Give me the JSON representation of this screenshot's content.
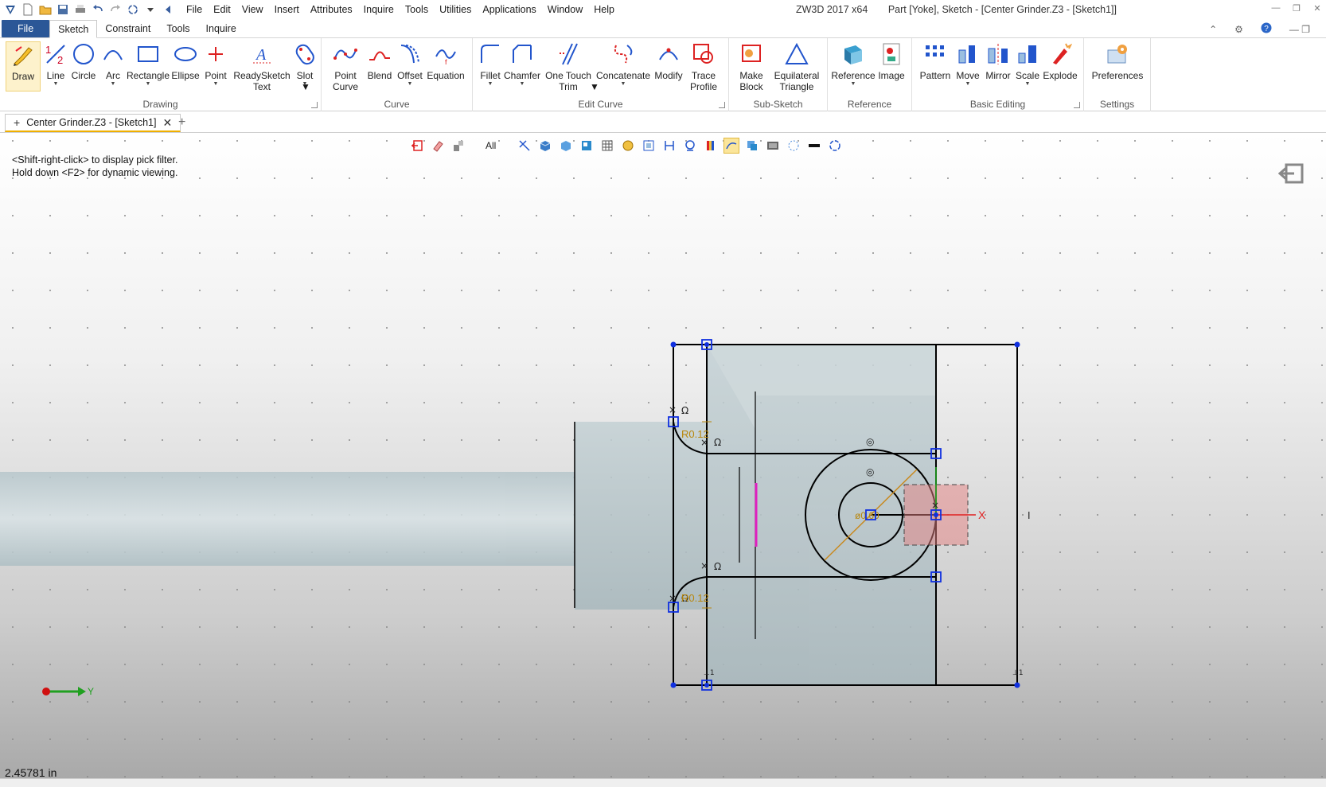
{
  "title_bar": {
    "menu": [
      "File",
      "Edit",
      "View",
      "Insert",
      "Attributes",
      "Inquire",
      "Tools",
      "Utilities",
      "Applications",
      "Window",
      "Help"
    ],
    "app_version": "ZW3D 2017  x64",
    "document_title": "Part [Yoke],  Sketch - [Center Grinder.Z3 - [Sketch1]]"
  },
  "ribbon_tabs": [
    "File",
    "Sketch",
    "Constraint",
    "Tools",
    "Inquire"
  ],
  "ribbon": {
    "groups": {
      "drawing": "Drawing",
      "curve": "Curve",
      "edit_curve": "Edit Curve",
      "sub_sketch": "Sub-Sketch",
      "reference": "Reference",
      "basic_editing": "Basic Editing",
      "settings": "Settings"
    },
    "tools": {
      "draw": "Draw",
      "line": "Line",
      "circle": "Circle",
      "arc": "Arc",
      "rectangle": "Rectangle",
      "ellipse": "Ellipse",
      "point": "Point",
      "readysketch_text_1": "ReadySketch",
      "readysketch_text_2": "Text",
      "slot": "Slot",
      "point_curve_1": "Point",
      "point_curve_2": "Curve",
      "blend": "Blend",
      "offset": "Offset",
      "equation": "Equation",
      "fillet": "Fillet",
      "chamfer": "Chamfer",
      "one_touch_trim_1": "One Touch",
      "one_touch_trim_2": "Trim",
      "concatenate": "Concatenate",
      "modify": "Modify",
      "trace_profile_1": "Trace",
      "trace_profile_2": "Profile",
      "make_block_1": "Make",
      "make_block_2": "Block",
      "equilateral_triangle_1": "Equilateral",
      "equilateral_triangle_2": "Triangle",
      "reference": "Reference",
      "image": "Image",
      "pattern": "Pattern",
      "move": "Move",
      "mirror": "Mirror",
      "scale": "Scale",
      "explode": "Explode",
      "preferences": "Preferences"
    }
  },
  "document_tab": {
    "label": "Center Grinder.Z3 - [Sketch1]"
  },
  "view_toolbar": {
    "filter_label": "All"
  },
  "viewport": {
    "hint_1": "<Shift-right-click> to display pick filter.",
    "hint_2": "Hold down <F2> for dynamic viewing.",
    "dimension_top": "R0.12",
    "dimension_bottom": "R0.12",
    "diameter_label": "ø0.60",
    "axis_x": "X",
    "axis_y": "Y",
    "units_readout": "2.45781 in"
  },
  "colors": {
    "accent": "#2b5797",
    "sketch_line": "#000000",
    "handle": "#1030e0",
    "dimension": "#b8860b",
    "model_fill": "#b9c8cc",
    "highlight": "#e020c0"
  }
}
